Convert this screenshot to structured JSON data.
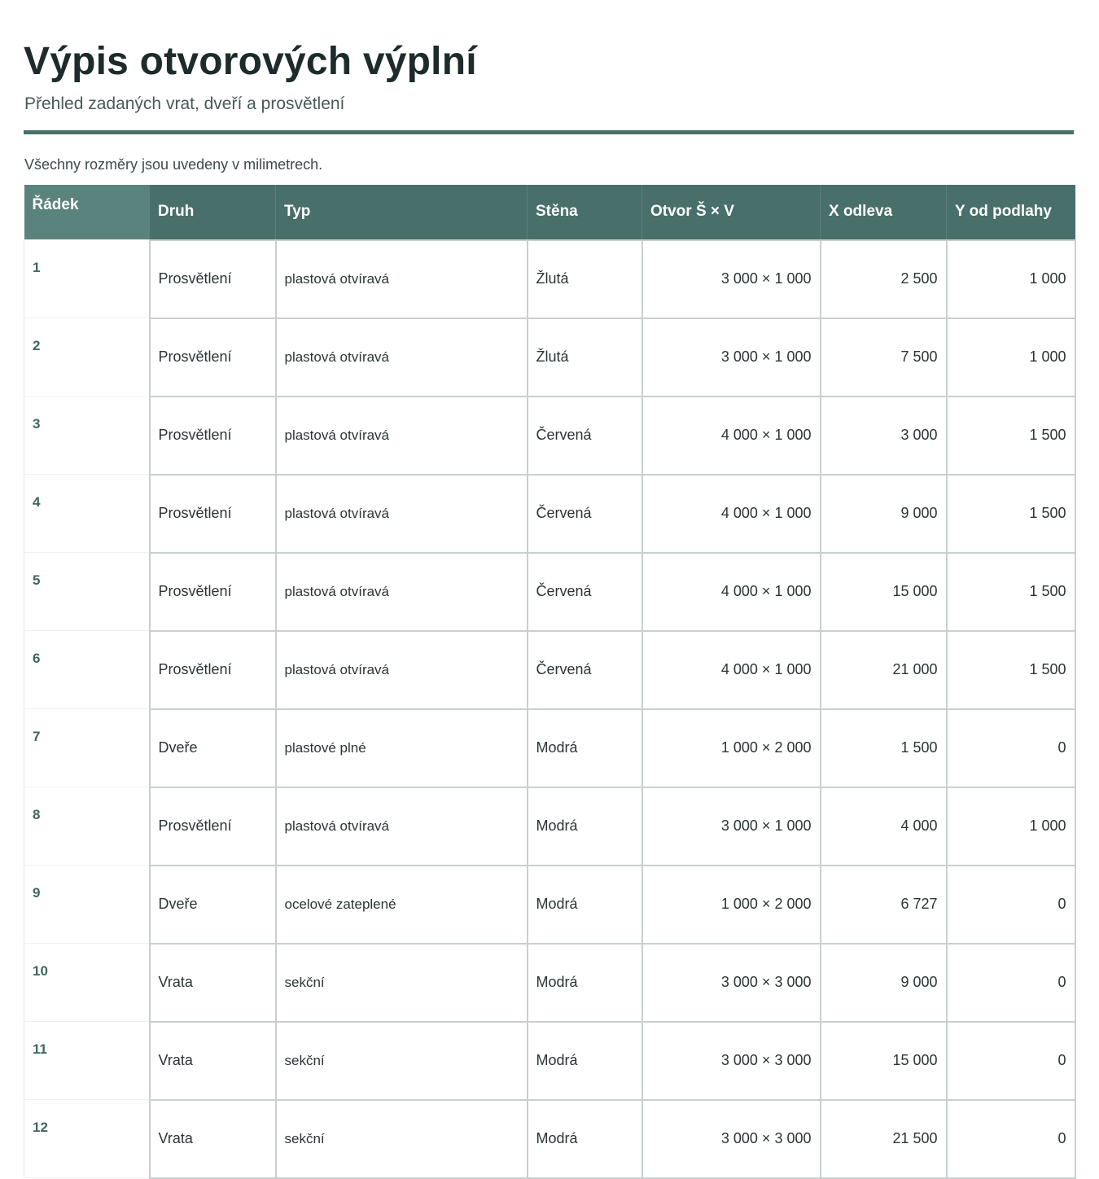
{
  "page": {
    "title": "Výpis otvorových výplní",
    "subtitle": "Přehled zadaných vrat, dveří a prosvětlení",
    "note": "Všechny rozměry jsou uvedeny v milimetrech."
  },
  "colors": {
    "accent": "#486f6a",
    "header_text": "#ffffff",
    "row_number": "#3f6661",
    "border": "#c8d0cf"
  },
  "table": {
    "headers": [
      "Řádek",
      "Druh",
      "Typ",
      "Stěna",
      "Otvor Š × V",
      "X odleva",
      "Y od podlahy"
    ],
    "rows": [
      [
        "1",
        "Prosvětlení",
        "plastová otvíravá",
        "Žlutá",
        "3 000 × 1 000",
        "2 500",
        "1 000"
      ],
      [
        "2",
        "Prosvětlení",
        "plastová otvíravá",
        "Žlutá",
        "3 000 × 1 000",
        "7 500",
        "1 000"
      ],
      [
        "3",
        "Prosvětlení",
        "plastová otvíravá",
        "Červená",
        "4 000 × 1 000",
        "3 000",
        "1 500"
      ],
      [
        "4",
        "Prosvětlení",
        "plastová otvíravá",
        "Červená",
        "4 000 × 1 000",
        "9 000",
        "1 500"
      ],
      [
        "5",
        "Prosvětlení",
        "plastová otvíravá",
        "Červená",
        "4 000 × 1 000",
        "15 000",
        "1 500"
      ],
      [
        "6",
        "Prosvětlení",
        "plastová otvíravá",
        "Červená",
        "4 000 × 1 000",
        "21 000",
        "1 500"
      ],
      [
        "7",
        "Dveře",
        "plastové plné",
        "Modrá",
        "1 000 × 2 000",
        "1 500",
        "0"
      ],
      [
        "8",
        "Prosvětlení",
        "plastová otvíravá",
        "Modrá",
        "3 000 × 1 000",
        "4 000",
        "1 000"
      ],
      [
        "9",
        "Dveře",
        "ocelové zateplené",
        "Modrá",
        "1 000 × 2 000",
        "6 727",
        "0"
      ],
      [
        "10",
        "Vrata",
        "sekční",
        "Modrá",
        "3 000 × 3 000",
        "9 000",
        "0"
      ],
      [
        "11",
        "Vrata",
        "sekční",
        "Modrá",
        "3 000 × 3 000",
        "15 000",
        "0"
      ],
      [
        "12",
        "Vrata",
        "sekční",
        "Modrá",
        "3 000 × 3 000",
        "21 500",
        "0"
      ]
    ]
  }
}
